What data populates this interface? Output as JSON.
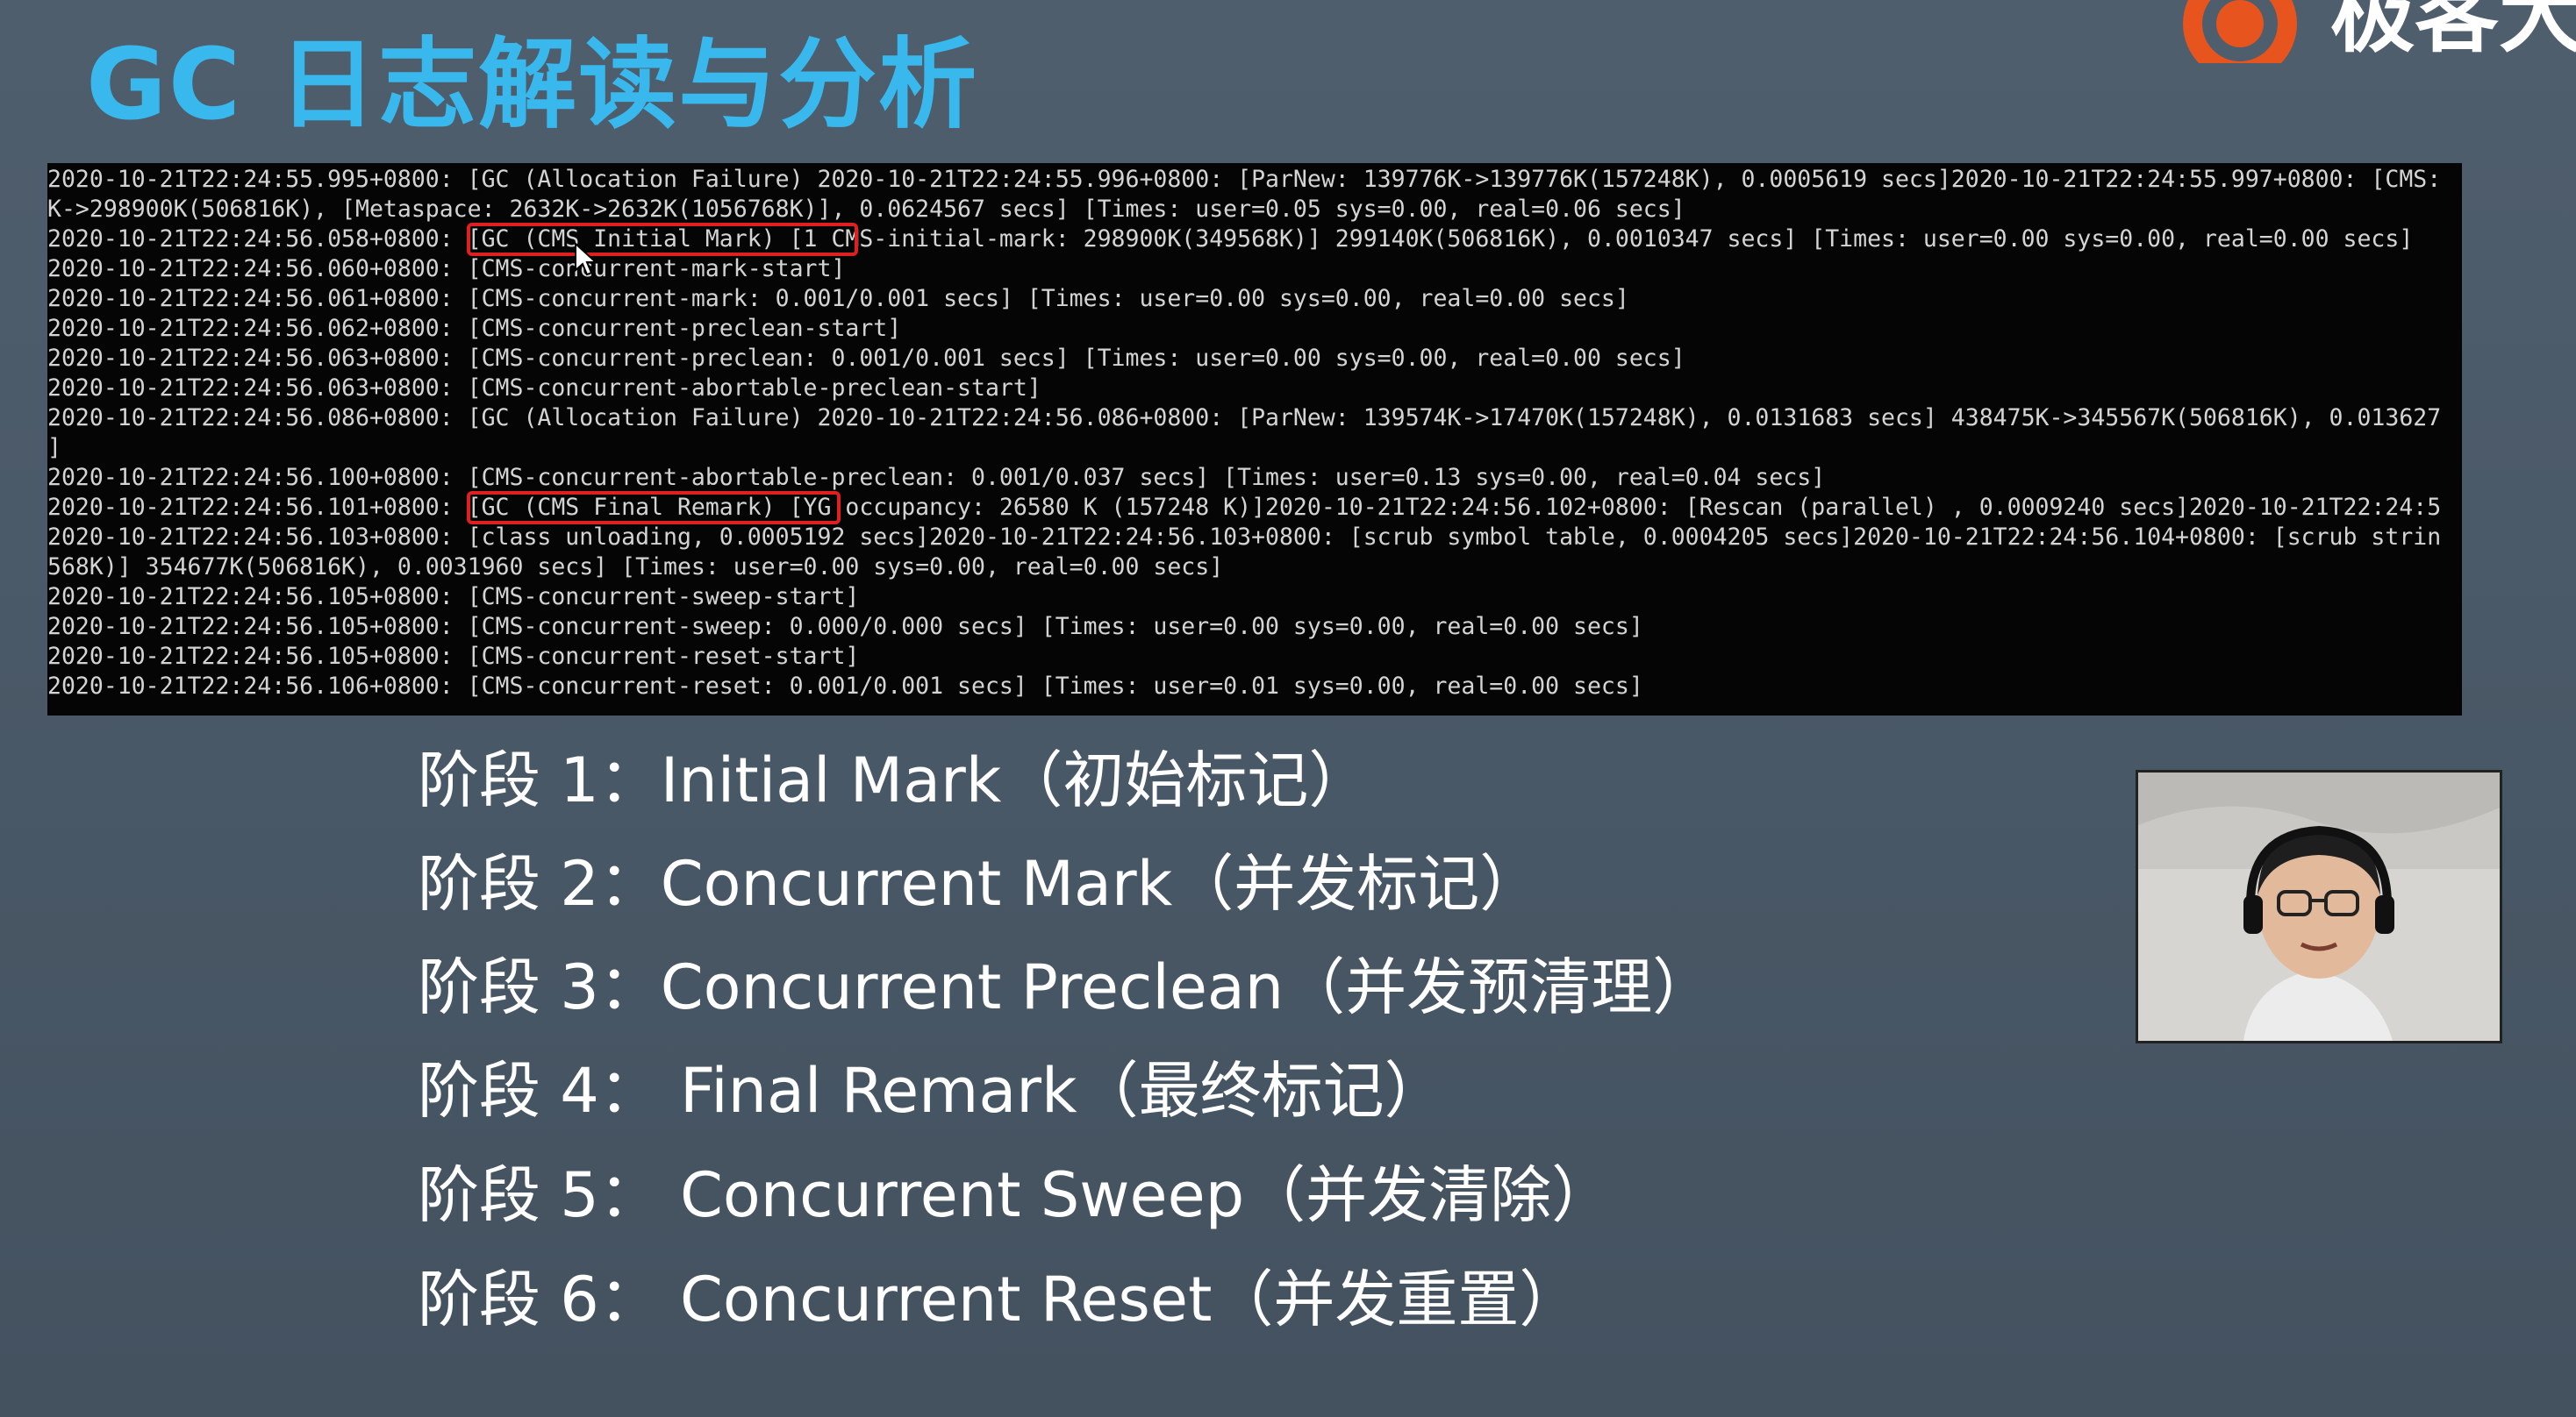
{
  "slide": {
    "title": "GC 日志解读与分析",
    "brand_text": "极客大"
  },
  "terminal": {
    "lines": [
      "2020-10-21T22:24:55.995+0800: [GC (Allocation Failure) 2020-10-21T22:24:55.996+0800: [ParNew: 139776K->139776K(157248K), 0.0005619 secs]2020-10-21T22:24:55.997+0800: [CMS:",
      "K->298900K(506816K), [Metaspace: 2632K->2632K(1056768K)], 0.0624567 secs] [Times: user=0.05 sys=0.00, real=0.06 secs]",
      "2020-10-21T22:24:56.058+0800: [GC (CMS Initial Mark) [1 CMS-initial-mark: 298900K(349568K)] 299140K(506816K), 0.0010347 secs] [Times: user=0.00 sys=0.00, real=0.00 secs]",
      "2020-10-21T22:24:56.060+0800: [CMS-concurrent-mark-start]",
      "2020-10-21T22:24:56.061+0800: [CMS-concurrent-mark: 0.001/0.001 secs] [Times: user=0.00 sys=0.00, real=0.00 secs]",
      "2020-10-21T22:24:56.062+0800: [CMS-concurrent-preclean-start]",
      "2020-10-21T22:24:56.063+0800: [CMS-concurrent-preclean: 0.001/0.001 secs] [Times: user=0.00 sys=0.00, real=0.00 secs]",
      "2020-10-21T22:24:56.063+0800: [CMS-concurrent-abortable-preclean-start]",
      "2020-10-21T22:24:56.086+0800: [GC (Allocation Failure) 2020-10-21T22:24:56.086+0800: [ParNew: 139574K->17470K(157248K), 0.0131683 secs] 438475K->345567K(506816K), 0.013627",
      "]",
      "2020-10-21T22:24:56.100+0800: [CMS-concurrent-abortable-preclean: 0.001/0.037 secs] [Times: user=0.13 sys=0.00, real=0.04 secs]",
      "2020-10-21T22:24:56.101+0800: [GC (CMS Final Remark) [YG occupancy: 26580 K (157248 K)]2020-10-21T22:24:56.102+0800: [Rescan (parallel) , 0.0009240 secs]2020-10-21T22:24:5",
      "2020-10-21T22:24:56.103+0800: [class unloading, 0.0005192 secs]2020-10-21T22:24:56.103+0800: [scrub symbol table, 0.0004205 secs]2020-10-21T22:24:56.104+0800: [scrub strin",
      "568K)] 354677K(506816K), 0.0031960 secs] [Times: user=0.00 sys=0.00, real=0.00 secs]",
      "2020-10-21T22:24:56.105+0800: [CMS-concurrent-sweep-start]",
      "2020-10-21T22:24:56.105+0800: [CMS-concurrent-sweep: 0.000/0.000 secs] [Times: user=0.00 sys=0.00, real=0.00 secs]",
      "2020-10-21T22:24:56.105+0800: [CMS-concurrent-reset-start]",
      "2020-10-21T22:24:56.106+0800: [CMS-concurrent-reset: 0.001/0.001 secs] [Times: user=0.01 sys=0.00, real=0.00 secs]"
    ],
    "highlights": [
      "[GC (CMS Initial Mark)",
      "[GC (CMS Final Remark)"
    ],
    "highlight_color": "#e02020",
    "text_color": "#d4d4d4",
    "background_color": "#050505"
  },
  "stages": [
    "阶段 1：Initial Mark（初始标记）",
    "阶段 2：Concurrent Mark（并发标记）",
    "阶段 3：Concurrent Preclean（并发预清理）",
    "阶段 4： Final Remark（最终标记）",
    "阶段 5： Concurrent Sweep（并发清除）",
    "阶段 6： Concurrent Reset（并发重置）"
  ],
  "colors": {
    "title": "#38b8ec",
    "brand_orange": "#e8541e",
    "slide_background": "#4a5866"
  },
  "icons": {
    "brand_logo": "brand-logo-icon",
    "mouse_cursor": "cursor-icon"
  }
}
